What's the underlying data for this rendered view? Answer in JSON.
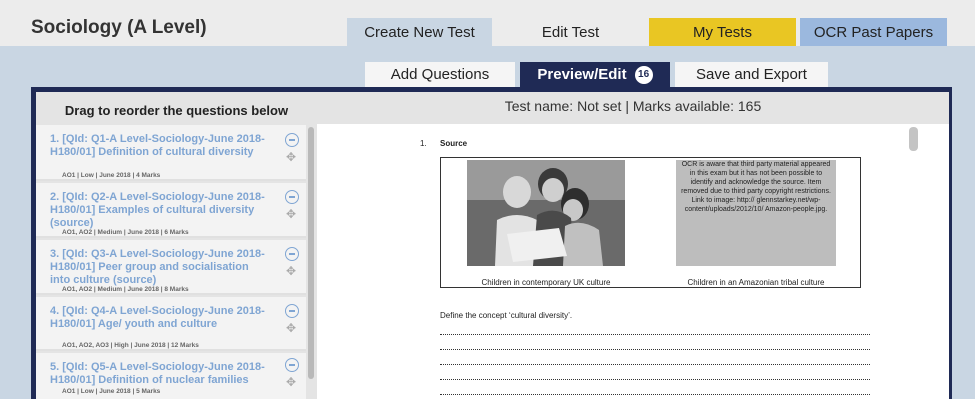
{
  "header": {
    "subject": "Sociology (A Level)",
    "tabs": {
      "create": "Create New Test",
      "edit": "Edit Test",
      "mytests": "My Tests",
      "ocr": "OCR Past Papers"
    }
  },
  "subtabs": {
    "add": "Add Questions",
    "preview": "Preview/Edit",
    "preview_count": "16",
    "save": "Save and Export"
  },
  "sidebar": {
    "heading": "Drag to reorder the questions below",
    "questions": [
      {
        "title": "1. [QId: Q1-A Level-Sociology-June 2018-H180/01] Definition of cultural diversity",
        "meta": "AO1 | Low | June 2018 | 4 Marks"
      },
      {
        "title": "2. [QId: Q2-A Level-Sociology-June 2018-H180/01] Examples of cultural diversity (source)",
        "meta": "AO1, AO2 | Medium | June 2018 | 6 Marks"
      },
      {
        "title": "3. [QId: Q3-A Level-Sociology-June 2018-H180/01] Peer group and socialisation into culture (source)",
        "meta": "AO1, AO2 | Medium | June 2018 | 8 Marks"
      },
      {
        "title": "4. [QId: Q4-A Level-Sociology-June 2018-H180/01] Age/ youth and culture",
        "meta": "AO1, AO2, AO3 | High | June 2018 | 12 Marks"
      },
      {
        "title": "5. [QId: Q5-A Level-Sociology-June 2018-H180/01] Definition of nuclear families",
        "meta": "AO1 | Low | June 2018 | 5 Marks"
      }
    ]
  },
  "test_info": "Test name: Not set | Marks available: 165",
  "preview": {
    "question_number": "1.",
    "source_label": "Source",
    "removed_notice": "OCR is aware that third party material appeared in this exam but it has not been possible to identify and acknowledge the source. Item removed due to third party copyright restrictions. Link to image: http:// glennstarkey.net/wp-content/uploads/2012/10/ Amazon-people.jpg.",
    "caption_a": "Children in contemporary UK culture",
    "caption_b": "Children in an Amazonian tribal culture",
    "prompt": "Define the concept ‘cultural diversity’."
  },
  "colors": {
    "navy": "#1f2a55",
    "yellow_tab": "#e9c623",
    "blue_tab": "#9bb8de",
    "link_blue": "#7fa5d3",
    "background": "#c9d6e3"
  }
}
